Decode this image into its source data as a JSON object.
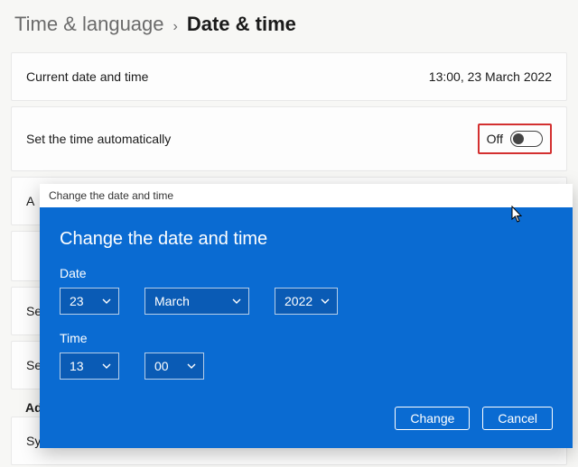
{
  "breadcrumb": {
    "parent": "Time & language",
    "current": "Date & time"
  },
  "cards": {
    "current": {
      "label": "Current date and time",
      "value": "13:00, 23 March 2022"
    },
    "auto": {
      "label": "Set the time automatically",
      "state": "Off"
    }
  },
  "fragments": {
    "adjust": "A",
    "row_c": " ",
    "row_se1": "Se",
    "row_se2": "Se",
    "additional": "Addi",
    "sync": "Sy"
  },
  "dialog": {
    "window_title": "Change the date and time",
    "title": "Change the date and time",
    "date_label": "Date",
    "time_label": "Time",
    "day": "23",
    "month": "March",
    "year": "2022",
    "hour": "13",
    "minute": "00",
    "change": "Change",
    "cancel": "Cancel"
  }
}
